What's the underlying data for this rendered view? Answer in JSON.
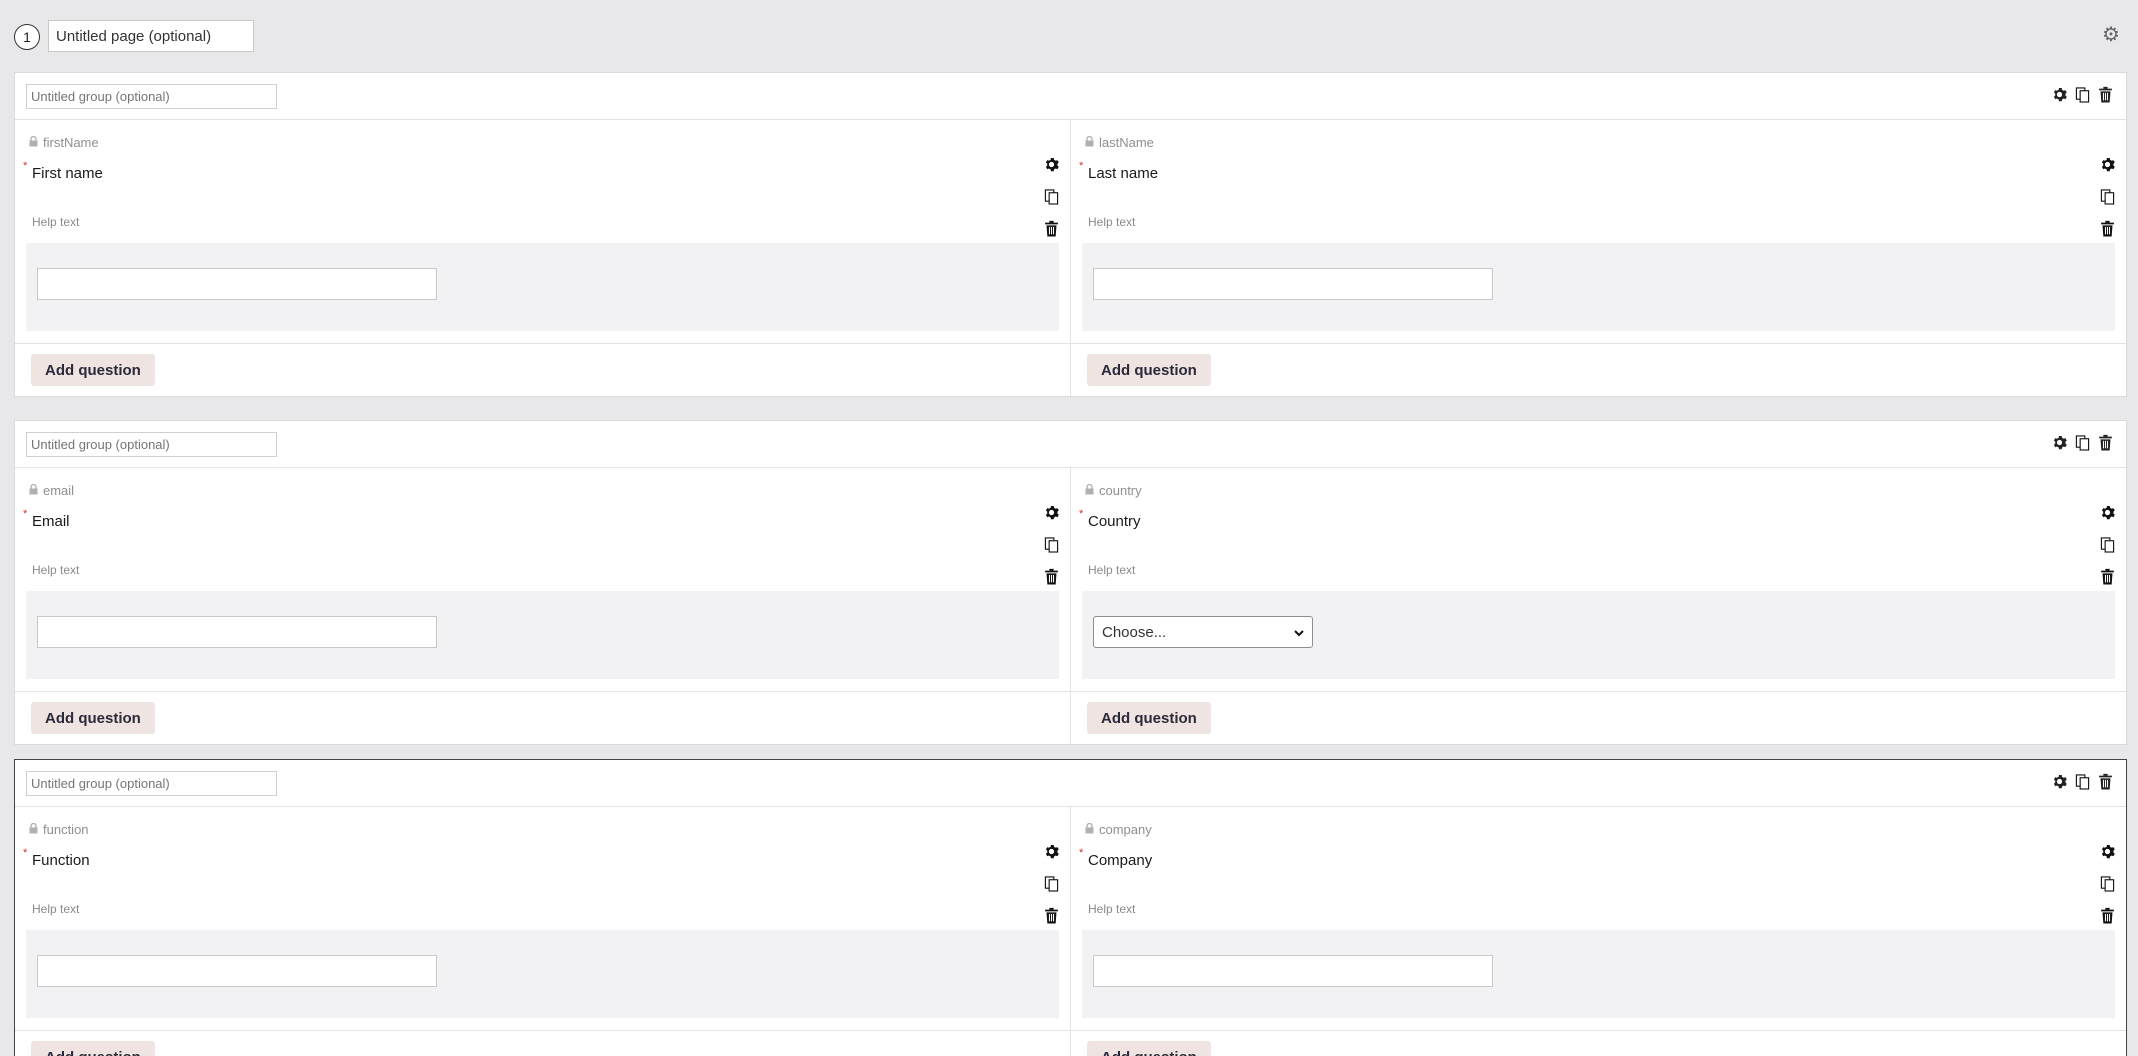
{
  "page": {
    "number": "1",
    "title_value": "Untitled page (optional)"
  },
  "groups": [
    {
      "title_placeholder": "Untitled group (optional)",
      "columns": [
        {
          "key": "firstName",
          "label": "First name",
          "help": "Help text",
          "input_type": "text",
          "add_label": "Add question"
        },
        {
          "key": "lastName",
          "label": "Last name",
          "help": "Help text",
          "input_type": "text",
          "add_label": "Add question"
        }
      ]
    },
    {
      "title_placeholder": "Untitled group (optional)",
      "columns": [
        {
          "key": "email",
          "label": "Email",
          "help": "Help text",
          "input_type": "text",
          "add_label": "Add question"
        },
        {
          "key": "country",
          "label": "Country",
          "help": "Help text",
          "input_type": "select",
          "select_value": "Choose...",
          "add_label": "Add question"
        }
      ]
    },
    {
      "title_placeholder": "Untitled group (optional)",
      "selected": true,
      "columns": [
        {
          "key": "function",
          "label": "Function",
          "help": "Help text",
          "input_type": "text",
          "add_label": "Add question"
        },
        {
          "key": "company",
          "label": "Company",
          "help": "Help text",
          "input_type": "text",
          "add_label": "Add question"
        }
      ]
    }
  ],
  "required_marker": "*",
  "icons": {
    "page_settings": "gear-icon",
    "settings": "gear-icon",
    "duplicate": "copy-icon",
    "delete": "trash-icon",
    "locked": "lock-icon",
    "select_arrow": "chevron-down-icon"
  },
  "colors": {
    "background": "#e8e8ea",
    "required": "#e12b2b",
    "add_button": "#f0e4e2",
    "preview_area": "#f2f2f4"
  }
}
